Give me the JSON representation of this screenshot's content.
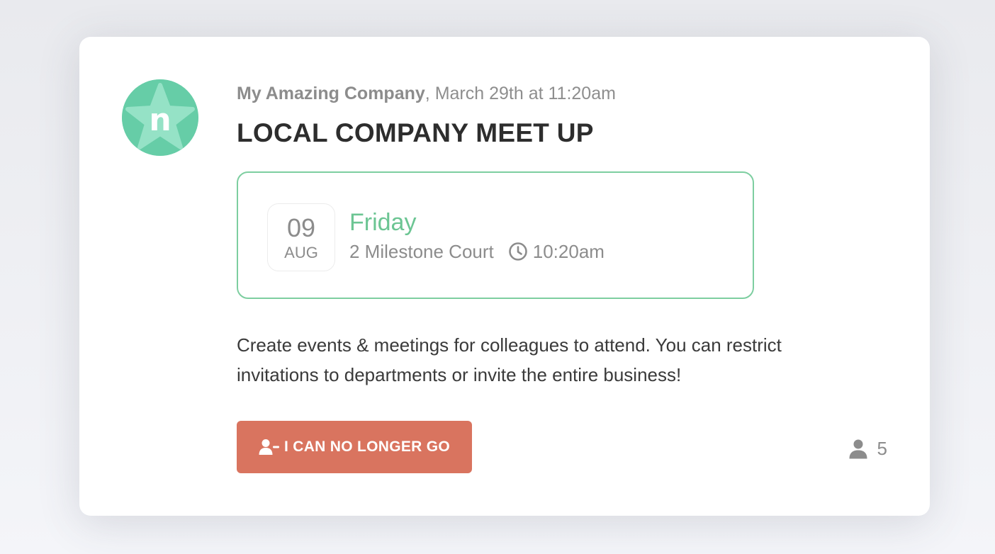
{
  "post": {
    "company": "My Amazing Company",
    "separator": ",",
    "posted_at": "March 29th at 11:20am",
    "title": "LOCAL COMPANY MEET UP",
    "avatar_letter": "n"
  },
  "event": {
    "day": "09",
    "month": "AUG",
    "weekday": "Friday",
    "location": "2 Milestone Court",
    "time": "10:20am"
  },
  "description": "Create events & meetings for colleagues to attend. You can restrict invitations to departments or invite the entire business!",
  "actions": {
    "leave_label": "I CAN NO LONGER GO"
  },
  "attendees": {
    "count": "5"
  },
  "colors": {
    "accent_green": "#6cc593",
    "avatar_green": "#66cda7",
    "button_red": "#d9745f"
  },
  "icons": {
    "avatar": "star-logo-icon",
    "time": "clock-icon",
    "leave": "user-minus-icon",
    "attendees": "person-icon"
  }
}
